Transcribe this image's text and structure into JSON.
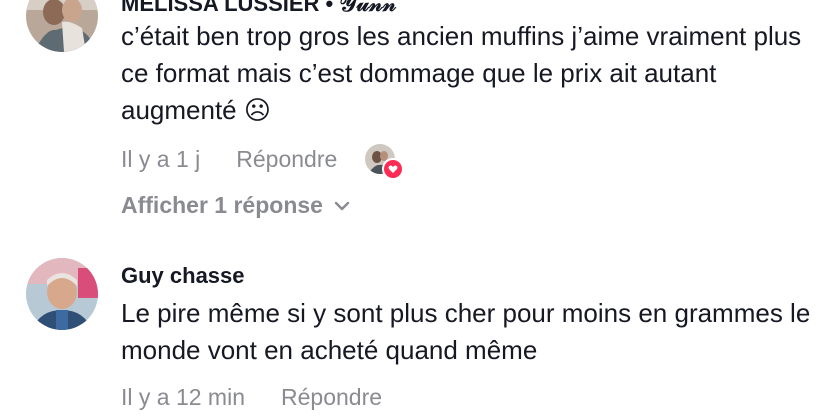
{
  "comments": [
    {
      "author": "MELISSA LUSSIER • 𝒴𝓊𝓃𝓃",
      "text": "c’était ben trop gros les ancien muffins j’aime vraiment plus ce format mais c’est dommage que le prix ait autant augmenté ☹",
      "time": "Il y a 1 j",
      "reply_label": "Répondre",
      "view_replies_label": "Afficher 1 réponse",
      "liked_by_creator": true
    },
    {
      "author": "Guy chasse",
      "text": "Le pire même si y sont plus cher pour moins en grammes le monde vont en acheté quand même",
      "time": "Il y a 12 min",
      "reply_label": "Répondre"
    }
  ],
  "colors": {
    "text": "#161823",
    "secondary": "#8a8b91",
    "heart": "#fe2c55"
  },
  "icons": [
    "chevron-down-icon",
    "heart-icon"
  ]
}
